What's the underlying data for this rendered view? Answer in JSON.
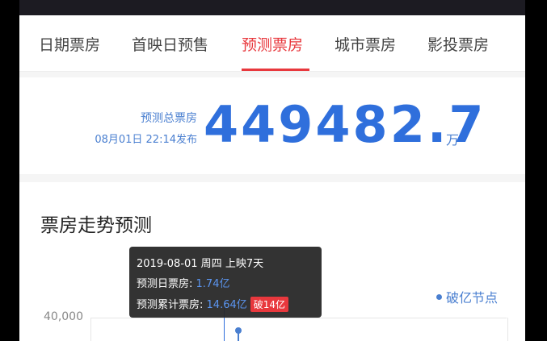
{
  "tabs": [
    {
      "label": "日期票房",
      "active": false
    },
    {
      "label": "首映日预售",
      "active": false
    },
    {
      "label": "预测票房",
      "active": true
    },
    {
      "label": "城市票房",
      "active": false
    },
    {
      "label": "影投票房",
      "active": false
    }
  ],
  "total": {
    "label": "预测总票房",
    "time": "08月01日 22:14发布",
    "value": "449482.7",
    "unit": "万"
  },
  "chart": {
    "title": "票房走势预测",
    "legend": "破亿节点",
    "y_tick": "40,000"
  },
  "tooltip": {
    "date": "2019-08-01 周四 上映7天",
    "daily_label": "预测日票房:",
    "daily_value": "1.74亿",
    "cum_label": "预测累计票房:",
    "cum_value": "14.64亿",
    "badge": "破14亿"
  },
  "colors": {
    "accent": "#e8383d",
    "blue": "#2f6fdc"
  }
}
